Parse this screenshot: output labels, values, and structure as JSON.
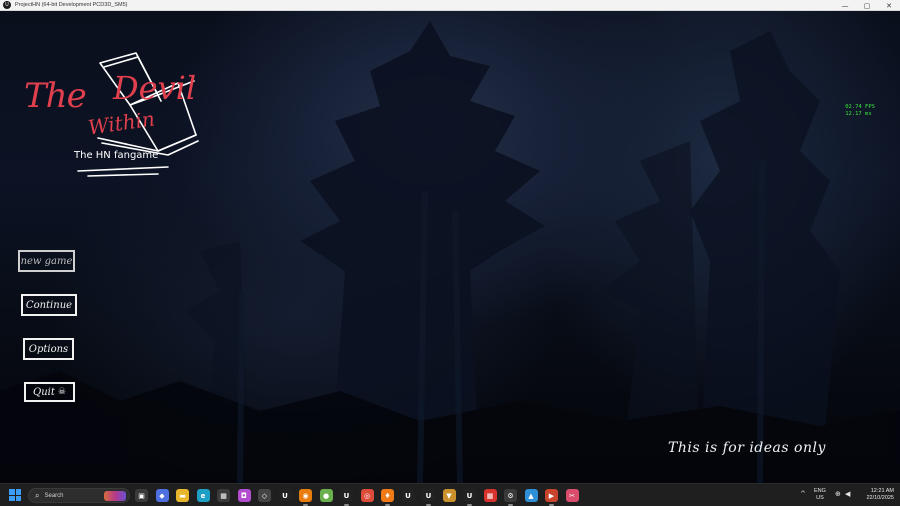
{
  "window": {
    "title": "ProjectHN (64-bit Development PCD3D_SM5)",
    "app_icon_glyph": "U",
    "controls": {
      "minimize": "—",
      "maximize": "▢",
      "close": "✕"
    }
  },
  "logo": {
    "word_the": "The",
    "word_devil": "Devil",
    "word_within": "Within",
    "subtitle": "The HN fangame",
    "color_title": "#e0404e",
    "color_outline": "#ffffff"
  },
  "menu": {
    "new_game": "new game",
    "continue": "Continue",
    "options": "Options",
    "quit": "Quit",
    "quit_icon": "skull-icon"
  },
  "stats": {
    "fps": "02.74 FPS",
    "ms": "12.17 ms",
    "color": "#39e43a"
  },
  "disclaimer": "This is for ideas only",
  "taskbar": {
    "search_placeholder": "Search",
    "apps": [
      {
        "name": "task-view",
        "glyph": "▣",
        "color": "#3a3a3a"
      },
      {
        "name": "copilot",
        "glyph": "◆",
        "color": "#4d6fe0"
      },
      {
        "name": "file-explorer",
        "glyph": "▬",
        "color": "#e8b62c"
      },
      {
        "name": "edge",
        "glyph": "e",
        "color": "#1ea0c4"
      },
      {
        "name": "store",
        "glyph": "▦",
        "color": "#3b3b3b"
      },
      {
        "name": "photos",
        "glyph": "◘",
        "color": "#b34dcf"
      },
      {
        "name": "roblox",
        "glyph": "◇",
        "color": "#444"
      },
      {
        "name": "unreal-1",
        "glyph": "U",
        "color": "#222"
      },
      {
        "name": "blender",
        "glyph": "◉",
        "color": "#e87d0d"
      },
      {
        "name": "steam-like",
        "glyph": "●",
        "color": "#6ab04c"
      },
      {
        "name": "unreal-2",
        "glyph": "U",
        "color": "#222"
      },
      {
        "name": "chrome",
        "glyph": "◎",
        "color": "#dd4b39"
      },
      {
        "name": "fire-app",
        "glyph": "♦",
        "color": "#f07a18"
      },
      {
        "name": "unreal-3",
        "glyph": "U",
        "color": "#222"
      },
      {
        "name": "unreal-4",
        "glyph": "U",
        "color": "#222"
      },
      {
        "name": "shield-app",
        "glyph": "▼",
        "color": "#c9902b"
      },
      {
        "name": "unreal-5",
        "glyph": "U",
        "color": "#222"
      },
      {
        "name": "red-app",
        "glyph": "▦",
        "color": "#d7322b"
      },
      {
        "name": "settings",
        "glyph": "⚙",
        "color": "#3a3a3a"
      },
      {
        "name": "landscape-app",
        "glyph": "▲",
        "color": "#2e8fd6"
      },
      {
        "name": "media-player",
        "glyph": "▶",
        "color": "#c8442c"
      },
      {
        "name": "snipping-tool",
        "glyph": "✂",
        "color": "#d94c6b"
      }
    ],
    "tray": {
      "chevron": "^",
      "lang_top": "ENG",
      "lang_bottom": "US",
      "network_icon": "⊕",
      "volume_icon": "◀",
      "time": "12:21 AM",
      "date": "22/10/2025"
    }
  }
}
